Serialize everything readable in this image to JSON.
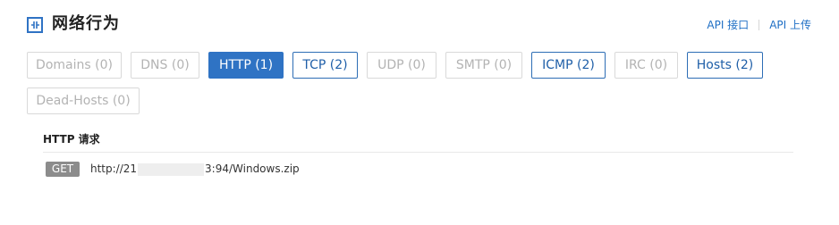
{
  "header": {
    "icon": "network-behavior-icon",
    "title": "网络行为",
    "api_links": [
      "API 接口",
      "API 上传"
    ],
    "accent_color": "#2f73c4"
  },
  "tabs": [
    {
      "label": "Domains (0)",
      "state": "disabled"
    },
    {
      "label": "DNS (0)",
      "state": "disabled"
    },
    {
      "label": "HTTP (1)",
      "state": "active"
    },
    {
      "label": "TCP (2)",
      "state": "enabled"
    },
    {
      "label": "UDP (0)",
      "state": "disabled"
    },
    {
      "label": "SMTP (0)",
      "state": "disabled"
    },
    {
      "label": "ICMP (2)",
      "state": "enabled"
    },
    {
      "label": "IRC (0)",
      "state": "disabled"
    },
    {
      "label": "Hosts (2)",
      "state": "enabled"
    },
    {
      "label": "Dead-Hosts (0)",
      "state": "disabled"
    }
  ],
  "http_section": {
    "title": "HTTP 请求",
    "requests": [
      {
        "method": "GET",
        "url_start": "http://21",
        "url_end": "3:94/Windows.zip"
      }
    ]
  }
}
